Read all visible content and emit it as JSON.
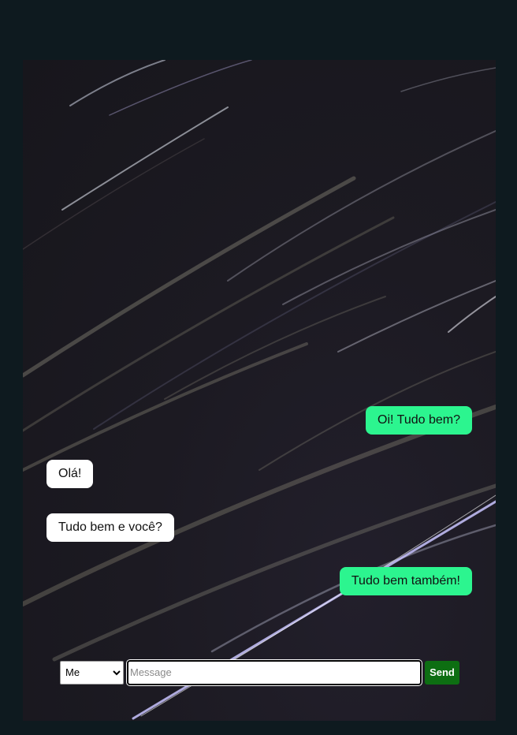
{
  "messages": [
    {
      "sender": "me",
      "text": "Oi! Tudo bem?"
    },
    {
      "sender": "other",
      "text": "Olá!"
    },
    {
      "sender": "other",
      "text": "Tudo bem e você?"
    },
    {
      "sender": "me",
      "text": "Tudo bem também!"
    }
  ],
  "composer": {
    "sender_selected": "Me",
    "message_placeholder": "Message",
    "message_value": "",
    "send_label": "Send"
  },
  "colors": {
    "page_background": "#0e1a1f",
    "my_bubble": "#2cf58f",
    "other_bubble": "#ffffff",
    "send_button": "#0d6e12"
  }
}
